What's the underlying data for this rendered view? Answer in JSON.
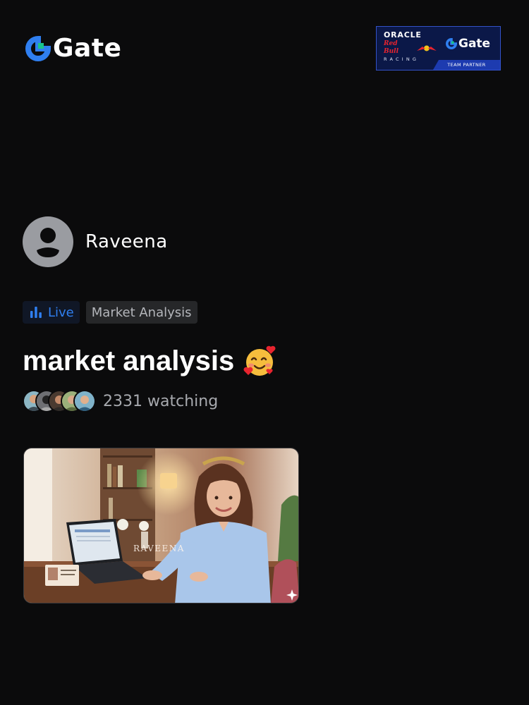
{
  "header": {
    "brand_name": "Gate",
    "brand_color": "#2f7ff0",
    "brand_accent": "#19c48b",
    "partner_badge": {
      "oracle": "ORACLE",
      "redbull": "Red Bull",
      "racing": "RACING",
      "brand": "Gate",
      "tagline": "TEAM PARTNER"
    }
  },
  "host": {
    "name": "Raveena",
    "avatar_icon": "default-user-icon"
  },
  "tags": {
    "live_label": "Live",
    "category": "Market Analysis"
  },
  "stream": {
    "title": "market analysis",
    "emoji": "🥰",
    "viewer_count": "2331",
    "viewer_label": "watching",
    "thumbnail_watermark": "RAVEENA"
  },
  "colors": {
    "background": "#0b0b0c",
    "live": "#2f7ff0",
    "muted_text": "#a7a9ae"
  }
}
